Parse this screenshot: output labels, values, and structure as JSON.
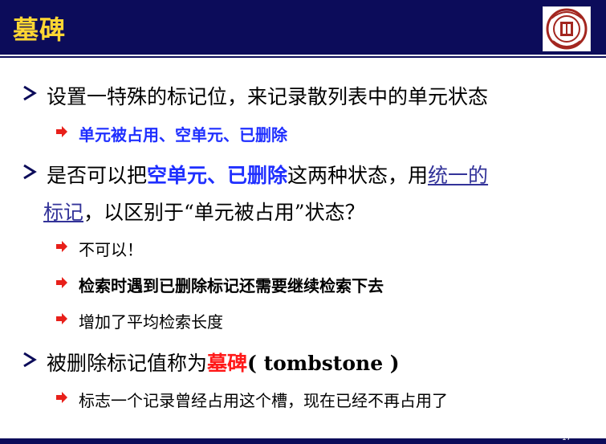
{
  "header": {
    "title": "墓碑",
    "logo_name": "university-seal",
    "page_number": "17"
  },
  "bullets": [
    {
      "level1": "设置一特殊的标记位，来记录散列表中的单元状态",
      "sub": [
        {
          "text": "单元被占用、空单元、已删除"
        }
      ]
    },
    {
      "part1": "是否可以把",
      "highlight": "空单元、已删除",
      "part2": "这两种状态，用",
      "link1": "统一的",
      "link2": "标记",
      "part3": "，以区别于“单元被占用”状态？",
      "sub": [
        {
          "text": "不可以！"
        },
        {
          "text": "检索时遇到已删除标记还需要继续检索下去"
        },
        {
          "text": "增加了平均检索长度"
        }
      ]
    },
    {
      "part1": "被删除标记值称为",
      "highlight": "墓碑",
      "part2": "( tombstone )",
      "sub": [
        {
          "text": "标志一个记录曾经占用这个槽，现在已经不再占用了"
        }
      ]
    }
  ],
  "colors": {
    "header_bg": "#0c0c5a",
    "title": "#ffd633",
    "highlight_blue": "#1f2fff",
    "highlight_red": "#ff1a1a",
    "bullet_arrow": "#e8201a",
    "link": "#333399"
  },
  "icons": {
    "level1_bullet": "chevron-right-icon",
    "level2_bullet": "red-arrow-icon"
  }
}
